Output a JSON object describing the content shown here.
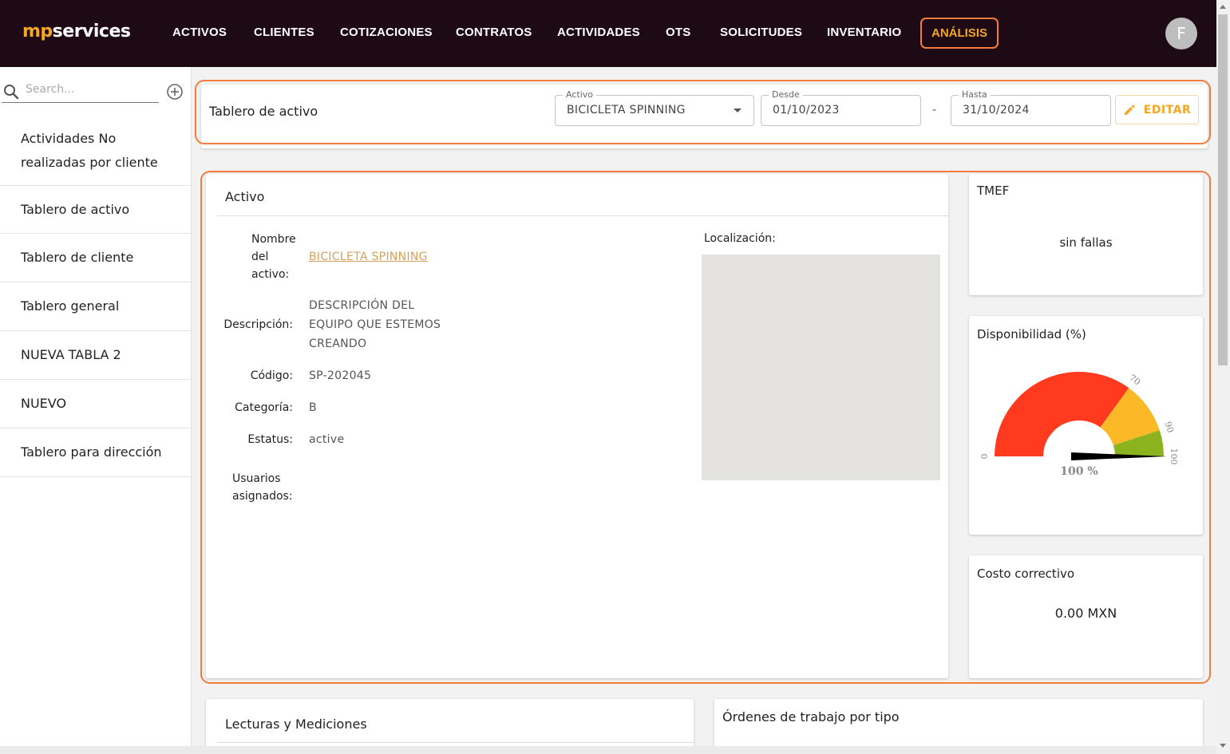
{
  "brand": {
    "part1": "mp",
    "part2": "services"
  },
  "nav": {
    "items": [
      "ACTIVOS",
      "CLIENTES",
      "COTIZACIONES",
      "CONTRATOS",
      "ACTIVIDADES",
      "OTS",
      "SOLICITUDES",
      "INVENTARIO"
    ],
    "active": "ANÁLISIS"
  },
  "user": {
    "initial": "F"
  },
  "sidebar": {
    "search_placeholder": "Search...",
    "items": [
      "Actividades No realizadas por cliente",
      "Tablero de activo",
      "Tablero de cliente",
      "Tablero general",
      "NUEVA TABLA 2",
      "NUEVO",
      "Tablero para dirección"
    ]
  },
  "header": {
    "title": "Tablero de activo",
    "activo_label": "Activo",
    "activo_value": "BICICLETA SPINNING",
    "desde_label": "Desde",
    "desde_value": "01/10/2023",
    "separator": "-",
    "hasta_label": "Hasta",
    "hasta_value": "31/10/2024",
    "edit_label": "EDITAR"
  },
  "asset": {
    "title": "Activo",
    "name_label": "Nombre del activo:",
    "name_value": "BICICLETA SPINNING",
    "desc_label": "Descripción:",
    "desc_value": "DESCRIPCIÓN DEL EQUIPO QUE ESTEMOS CREANDO",
    "code_label": "Código:",
    "code_value": "SP-202045",
    "cat_label": "Categoría:",
    "cat_value": "B",
    "status_label": "Estatus:",
    "status_value": "active",
    "users_label": "Usuarios asignados:",
    "location_label": "Localización:"
  },
  "tmef": {
    "title": "TMEF",
    "value": "sin fallas"
  },
  "availability": {
    "title": "Disponibilidad (%)",
    "value": 100,
    "value_text": "100 %",
    "ticks": [
      "0",
      "70",
      "90",
      "100"
    ],
    "bands": [
      {
        "from": 0,
        "to": 70,
        "color": "#ff3a1e"
      },
      {
        "from": 70,
        "to": 90,
        "color": "#fbb927"
      },
      {
        "from": 90,
        "to": 100,
        "color": "#8ab31e"
      }
    ]
  },
  "cost": {
    "title": "Costo correctivo",
    "value": "0.00 MXN"
  },
  "readings": {
    "title": "Lecturas y Mediciones"
  },
  "orders": {
    "title": "Órdenes de trabajo por tipo"
  }
}
